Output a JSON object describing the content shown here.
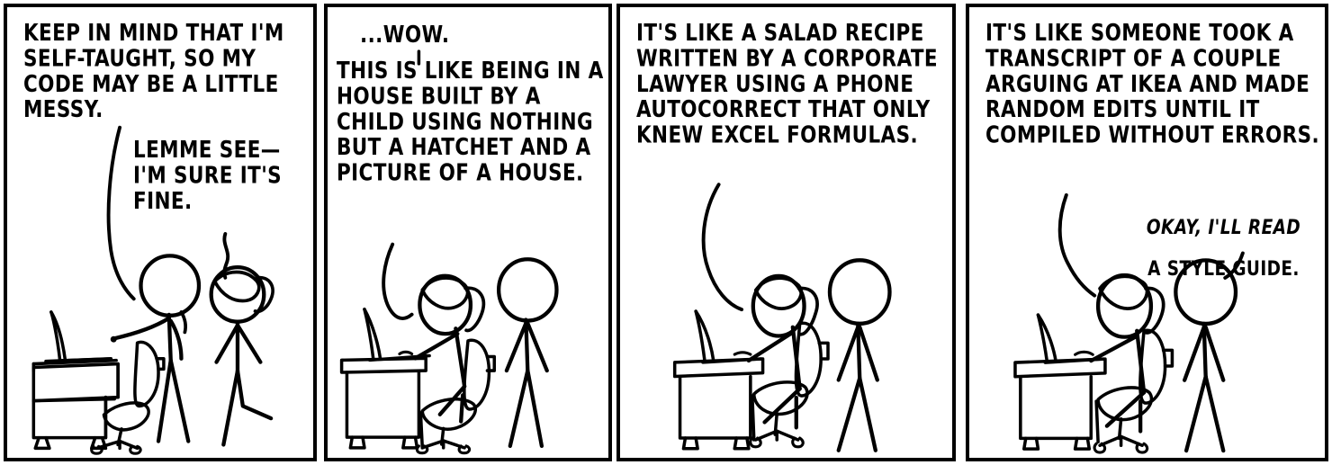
{
  "comic": {
    "title": "Self-Taught Code",
    "panel_count": 4,
    "ink_color": "#000000",
    "background_color": "#ffffff",
    "panels": [
      {
        "index": 1,
        "speech": [
          {
            "id": "p1a",
            "speaker": "ponytail-standing-figure",
            "text": "Keep in mind that I'm self-taught, so my code may be a little messy.",
            "style": "normal"
          },
          {
            "id": "p1b",
            "speaker": "cueball-standing-figure",
            "text": "Lemme see— I'm sure it's fine.",
            "style": "normal"
          }
        ],
        "objects": [
          "desk",
          "laptop",
          "office-chair",
          "standing-figure",
          "ponytail-figure"
        ]
      },
      {
        "index": 2,
        "speech": [
          {
            "id": "p2a",
            "speaker": "ponytail-seated-figure",
            "text": "...Wow.",
            "style": "normal"
          },
          {
            "id": "p2b",
            "speaker": "ponytail-seated-figure",
            "text": "This is like being in a house built by a child using nothing but a hatchet and a picture of a house.",
            "style": "normal"
          }
        ],
        "objects": [
          "desk",
          "laptop",
          "office-chair",
          "seated-ponytail-figure",
          "standing-figure"
        ]
      },
      {
        "index": 3,
        "speech": [
          {
            "id": "p3a",
            "speaker": "ponytail-seated-figure",
            "text": "It's like a salad recipe written by a corporate lawyer using a phone autocorrect that only knew Excel formulas.",
            "style": "normal"
          }
        ],
        "objects": [
          "desk",
          "laptop",
          "office-chair",
          "seated-ponytail-figure",
          "standing-figure"
        ]
      },
      {
        "index": 4,
        "speech": [
          {
            "id": "p4a",
            "speaker": "ponytail-seated-figure",
            "text": "It's like someone took a transcript of a couple arguing at Ikea and made random edits until it compiled without errors.",
            "style": "normal"
          },
          {
            "id": "p4b_italic",
            "speaker": "standing-figure",
            "text": "Okay, I'll read",
            "style": "italic"
          },
          {
            "id": "p4b_rest",
            "speaker": "standing-figure",
            "text": "a style guide.",
            "style": "normal"
          }
        ],
        "objects": [
          "desk",
          "laptop",
          "office-chair",
          "seated-ponytail-figure",
          "standing-figure"
        ]
      }
    ]
  }
}
